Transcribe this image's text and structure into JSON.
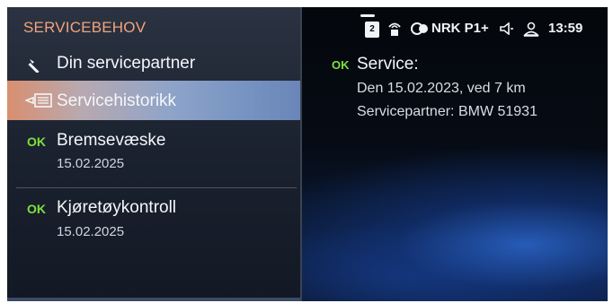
{
  "menu": {
    "title": "SERVICEBEHOV",
    "items": [
      {
        "label": "Din servicepartner",
        "icon": "wrench-icon"
      },
      {
        "label": "Servicehistorikk",
        "icon": "service-book-icon",
        "selected": true
      },
      {
        "status": "OK",
        "label": "Bremsevæske",
        "date": "15.02.2025"
      },
      {
        "status": "OK",
        "label": "Kjøretøykontroll",
        "date": "15.02.2025"
      }
    ]
  },
  "status_bar": {
    "badge": "2",
    "radio_icon": "radio-tower-icon",
    "source_icon": "connected-drive-icon",
    "station": "NRK P1+",
    "volume_icon": "speaker-icon",
    "profile_icon": "user-icon",
    "time": "13:59"
  },
  "detail": {
    "status": "OK",
    "title": "Service:",
    "line1": "Den 15.02.2023, ved 7 km",
    "line2": "Servicepartner: BMW 51931"
  },
  "colors": {
    "header_accent": "#f3a37d",
    "ok_green": "#7fe03c",
    "selection_start": "#d98f6f",
    "selection_end": "#6a86b8"
  }
}
